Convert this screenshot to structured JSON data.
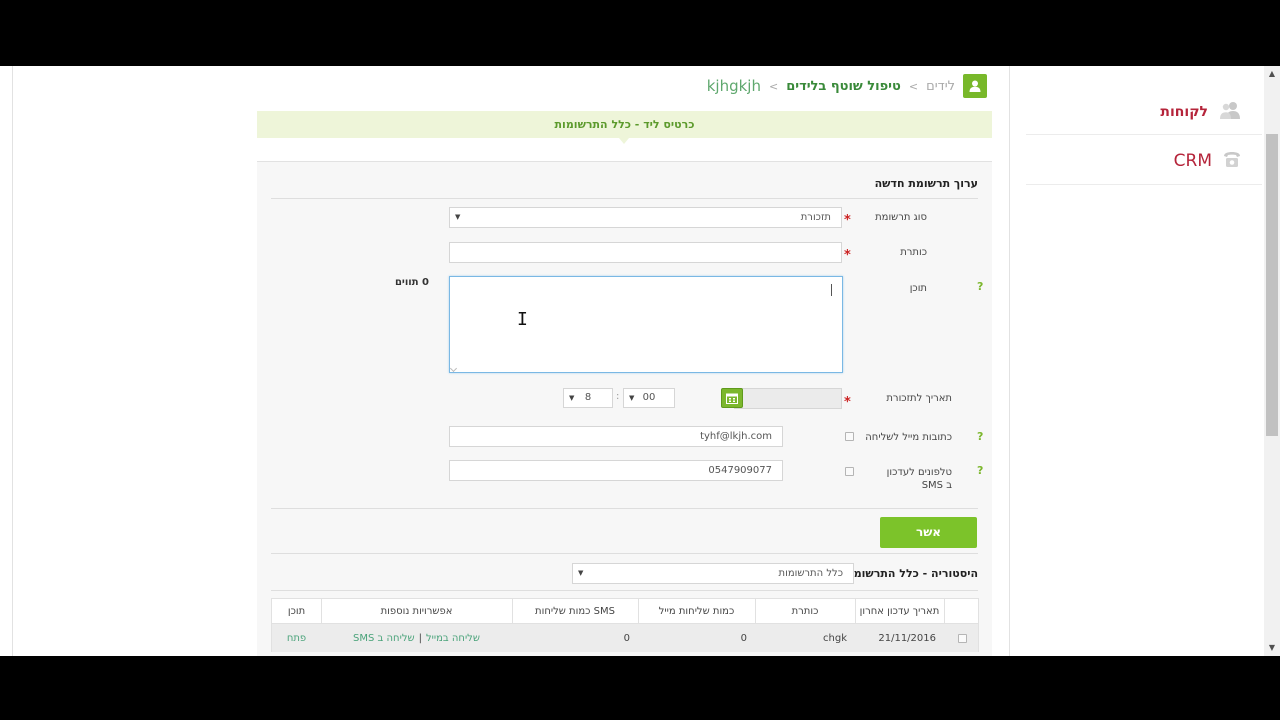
{
  "nav": {
    "customers_label": "לקוחות",
    "crm_label": "CRM"
  },
  "breadcrumb": {
    "leads": "לידים",
    "shared_handling": "טיפול שוטף בלידים",
    "current": "kjhgkjh",
    "separator": ">"
  },
  "notice": {
    "text": "כרטיס ליד - כלל התרשומות"
  },
  "form": {
    "title": "ערוך תרשומת חדשה",
    "type_label": "סוג תרשומת",
    "type_value": "תזכורת",
    "subject_label": "כותרת",
    "subject_value": "",
    "content_label": "תוכן",
    "char_count": "0 תווים",
    "reminder_label": "תאריך לתזכורת",
    "reminder_date": "",
    "minute_value": "00",
    "hour_value": "8",
    "time_sep": ":",
    "email_label": "כתובות מייל לשליחה",
    "email_value": "tyhf@lkjh.com",
    "sms_label": "טלפונים לעדכון ב SMS",
    "sms_value": "0547909077",
    "required_mark": "*",
    "help_mark": "?",
    "approve_label": "אשר"
  },
  "history": {
    "title": "היסטוריה - כלל התרשומות",
    "filter_value": "כלל התרשומות",
    "columns": {
      "last_update": "תאריך עדכון אחרון",
      "subject": "כותרת",
      "email_count": "כמות שליחות מייל",
      "sms_count": "כמות שליחות SMS",
      "options": "אפשרויות נוספות",
      "content": "תוכן"
    },
    "rows": [
      {
        "date": "21/11/2016",
        "subject": "chgk",
        "email_count": "0",
        "sms_count": "0",
        "send_email": "שליחה במייל",
        "pipe": "|",
        "send_sms": "שליחה ב SMS",
        "open": "פתח"
      }
    ]
  },
  "colors": {
    "accent_green": "#7cc32a",
    "nav_red": "#b5243a",
    "link_green": "#4aa37a"
  }
}
